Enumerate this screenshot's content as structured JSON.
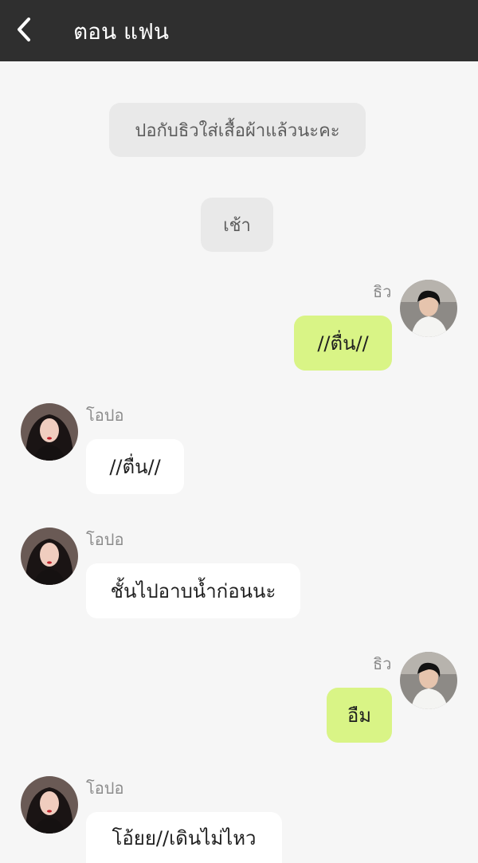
{
  "header": {
    "title": "ตอน แฟน",
    "back_icon": "chevron-left-icon"
  },
  "messages": [
    {
      "type": "system",
      "text": "ปอกับธิวใส่เสื้อผ้าแล้วนะคะ"
    },
    {
      "type": "system",
      "text": "เช้า"
    },
    {
      "type": "right",
      "sender": "ธิว",
      "text": "//ตื่น//"
    },
    {
      "type": "left",
      "sender": "โอปอ",
      "text": "//ตื่น//"
    },
    {
      "type": "left",
      "sender": "โอปอ",
      "text": "ชั้นไปอาบน้ำก่อนนะ"
    },
    {
      "type": "right",
      "sender": "ธิว",
      "text": "อืม"
    },
    {
      "type": "left",
      "sender": "โอปอ",
      "text": "โอ้ยย//เดินไม่ไหว"
    }
  ],
  "colors": {
    "header_bg": "#2f2f2f",
    "right_bubble": "#d9f486",
    "left_bubble": "#ffffff",
    "system_bubble": "#e9e9e9",
    "background": "#f6f6f6"
  }
}
